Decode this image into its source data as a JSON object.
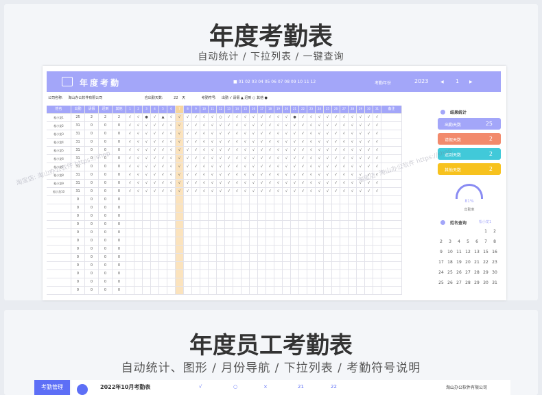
{
  "panel1": {
    "title": "年度考勤表",
    "subtitle": "自动统计 / 下拉列表 / 一键查询",
    "sheet": {
      "title": "年度考勤",
      "header_legend": "■ 01 02 03 04 05 06 07 08 09 10 11 12",
      "year_label": "考勤年份",
      "year": "2023",
      "nav_prev": "◀",
      "month": "1",
      "nav_next": "▶",
      "company_label": "公司名称:",
      "company": "淘山办公软件有限公司",
      "workdays_label": "应出勤天数:",
      "workdays": "22",
      "workdays_unit": "天",
      "symbols_label": "考勤符号:",
      "symbols": "出勤 √  请假 ▲  迟到 ○  其他 ●",
      "columns": [
        "姓名",
        "出勤",
        "请假",
        "迟到",
        "其他"
      ],
      "days": [
        "1",
        "2",
        "3",
        "4",
        "5",
        "6",
        "7",
        "8",
        "9",
        "10",
        "11",
        "12",
        "13",
        "14",
        "15",
        "16",
        "17",
        "18",
        "19",
        "20",
        "21",
        "22",
        "23",
        "24",
        "25",
        "26",
        "27",
        "28",
        "29",
        "30",
        "31"
      ],
      "remark_col": "备注",
      "rows": [
        {
          "name": "松小龙1",
          "v": [
            "25",
            "2",
            "2",
            "2"
          ]
        },
        {
          "name": "松小龙2",
          "v": [
            "31",
            "0",
            "0",
            "0"
          ]
        },
        {
          "name": "松小龙3",
          "v": [
            "31",
            "0",
            "0",
            "0"
          ]
        },
        {
          "name": "松小龙4",
          "v": [
            "31",
            "0",
            "0",
            "0"
          ]
        },
        {
          "name": "松小龙5",
          "v": [
            "31",
            "0",
            "0",
            "0"
          ]
        },
        {
          "name": "松小龙6",
          "v": [
            "31",
            "0",
            "0",
            "0"
          ]
        },
        {
          "name": "松小龙7",
          "v": [
            "31",
            "0",
            "0",
            "0"
          ]
        },
        {
          "name": "松小龙8",
          "v": [
            "31",
            "0",
            "0",
            "0"
          ]
        },
        {
          "name": "松小龙9",
          "v": [
            "31",
            "0",
            "0",
            "0"
          ]
        },
        {
          "name": "松小龙10",
          "v": [
            "31",
            "0",
            "0",
            "0"
          ]
        }
      ],
      "stats": {
        "title": "结果统计",
        "cards": [
          {
            "label": "出勤天数",
            "value": "25",
            "color": "#a3a6f9"
          },
          {
            "label": "请假天数",
            "value": "2",
            "color": "#f28a6c"
          },
          {
            "label": "迟到天数",
            "value": "2",
            "color": "#41c9d9"
          },
          {
            "label": "其他天数",
            "value": "2",
            "color": "#f7c21e"
          }
        ],
        "gauge_pct": "81%",
        "gauge_label": "出勤率"
      },
      "query": {
        "title": "姓名查询",
        "value": "松小龙1",
        "calendar": [
          [
            "",
            "",
            "",
            "",
            "",
            "1",
            "2"
          ],
          [
            "2",
            "3",
            "4",
            "5",
            "6",
            "7",
            "8"
          ],
          [
            "9",
            "10",
            "11",
            "12",
            "13",
            "15",
            "16"
          ],
          [
            "17",
            "18",
            "19",
            "20",
            "21",
            "22",
            "23"
          ],
          [
            "24",
            "25",
            "26",
            "27",
            "28",
            "29",
            "30"
          ],
          [
            "25",
            "26",
            "27",
            "28",
            "29",
            "30",
            "31"
          ]
        ]
      }
    }
  },
  "panel2": {
    "title": "年度员工考勤表",
    "subtitle": "自动统计、图形 / 月份导航 / 下拉列表 / 考勤符号说明",
    "nav_label": "考勤管理",
    "sheet_title": "2022年10月考勤表",
    "stats": [
      "√",
      "○",
      "×",
      "21",
      "22"
    ],
    "company": "淘山办公软件有限公司"
  },
  "watermark": "淘宝店: 淘山办公软件 https://shop"
}
